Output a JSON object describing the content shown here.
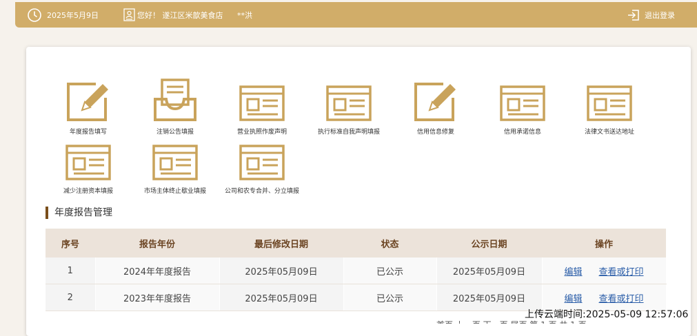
{
  "topbar": {
    "date": "2025年5月9日",
    "greeting": "您好！ 遂江区米歆美食店",
    "user": "**洪",
    "logout": "退出登录"
  },
  "tiles": [
    {
      "label": "年度报告填写",
      "icon": "edit-icon"
    },
    {
      "label": "注销公告填报",
      "icon": "inbox-icon"
    },
    {
      "label": "营业执照作废声明",
      "icon": "form-icon"
    },
    {
      "label": "执行标准自我声明填报",
      "icon": "form-icon"
    },
    {
      "label": "信用信息修复",
      "icon": "edit-icon"
    },
    {
      "label": "信用承诺信息",
      "icon": "form-icon"
    },
    {
      "label": "法律文书送达地址",
      "icon": "form-icon"
    },
    {
      "label": "减少注册资本填报",
      "icon": "form-icon"
    },
    {
      "label": "市场主体终止歇业填报",
      "icon": "form-icon"
    },
    {
      "label": "公司和农专合并、分立填报",
      "icon": "form-icon"
    }
  ],
  "section": {
    "title": "年度报告管理"
  },
  "table": {
    "headers": [
      "序号",
      "报告年份",
      "最后修改日期",
      "状态",
      "公示日期",
      "操作"
    ],
    "rows": [
      {
        "no": "1",
        "year": "2024年年度报告",
        "modified": "2025年05月09日",
        "status": "已公示",
        "published": "2025年05月09日",
        "edit": "编辑",
        "view": "查看或打印"
      },
      {
        "no": "2",
        "year": "2023年年度报告",
        "modified": "2025年05月09日",
        "status": "已公示",
        "published": "2025年05月09日",
        "edit": "编辑",
        "view": "查看或打印"
      }
    ]
  },
  "upload_time": "上传云端时间:2025-05-09 12:57:06",
  "pager": "首页 上一页 下一页 尾页 第 1 页 共 1 页",
  "colors": {
    "brand": "#d1ad69",
    "icon_gold": "#c9a35b",
    "header_text": "#6b4422",
    "link": "#2a5da8"
  }
}
